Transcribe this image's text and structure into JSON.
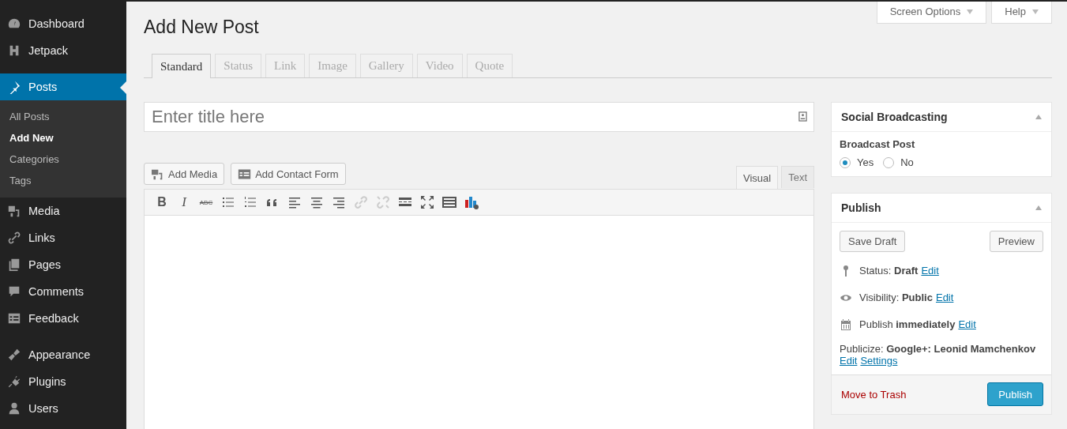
{
  "sidebar": {
    "groups": [
      [
        {
          "label": "Dashboard",
          "selected": false
        },
        {
          "label": "Jetpack",
          "selected": false
        }
      ],
      [
        {
          "label": "Posts",
          "selected": true,
          "children": [
            {
              "label": "All Posts",
              "selected": false
            },
            {
              "label": "Add New",
              "selected": true
            },
            {
              "label": "Categories",
              "selected": false
            },
            {
              "label": "Tags",
              "selected": false
            }
          ]
        },
        {
          "label": "Media",
          "selected": false
        },
        {
          "label": "Links",
          "selected": false
        },
        {
          "label": "Pages",
          "selected": false
        },
        {
          "label": "Comments",
          "selected": false
        },
        {
          "label": "Feedback",
          "selected": false
        }
      ],
      [
        {
          "label": "Appearance",
          "selected": false
        },
        {
          "label": "Plugins",
          "selected": false
        },
        {
          "label": "Users",
          "selected": false
        }
      ]
    ]
  },
  "screen_meta": [
    {
      "label": "Screen Options"
    },
    {
      "label": "Help"
    }
  ],
  "page_title": "Add New Post",
  "format_tabs": [
    {
      "label": "Standard",
      "selected": true
    },
    {
      "label": "Status",
      "selected": false
    },
    {
      "label": "Link",
      "selected": false
    },
    {
      "label": "Image",
      "selected": false
    },
    {
      "label": "Gallery",
      "selected": false
    },
    {
      "label": "Video",
      "selected": false
    },
    {
      "label": "Quote",
      "selected": false
    }
  ],
  "title_field": {
    "placeholder": "Enter title here"
  },
  "media_buttons": [
    {
      "label": "Add Media"
    },
    {
      "label": "Add Contact Form"
    }
  ],
  "editor_tabs": [
    {
      "label": "Visual",
      "selected": true
    },
    {
      "label": "Text",
      "selected": false
    }
  ],
  "toolbar": [
    {
      "kind": "bold",
      "label": "B",
      "disabled": false
    },
    {
      "kind": "italic",
      "label": "I",
      "disabled": false
    },
    {
      "kind": "strike",
      "label": "ABC",
      "disabled": false
    },
    {
      "kind": "bullets",
      "disabled": false
    },
    {
      "kind": "numbers",
      "disabled": false
    },
    {
      "kind": "quote",
      "disabled": false
    },
    {
      "kind": "align-left",
      "disabled": false
    },
    {
      "kind": "align-center",
      "disabled": false
    },
    {
      "kind": "align-right",
      "disabled": false
    },
    {
      "kind": "link",
      "disabled": true
    },
    {
      "kind": "unlink",
      "disabled": true
    },
    {
      "kind": "more",
      "disabled": false
    },
    {
      "kind": "fullscreen",
      "disabled": false
    },
    {
      "kind": "keyboard",
      "disabled": false
    },
    {
      "kind": "chart",
      "disabled": false
    }
  ],
  "social_box": {
    "title": "Social Broadcasting",
    "label": "Broadcast Post",
    "options": [
      {
        "label": "Yes",
        "selected": true
      },
      {
        "label": "No",
        "selected": false
      }
    ]
  },
  "publish_box": {
    "title": "Publish",
    "save_draft": "Save Draft",
    "preview": "Preview",
    "rows": [
      {
        "kind": "status",
        "text": "Status: **Draft**",
        "link": "Edit"
      },
      {
        "kind": "visibility",
        "text": "Visibility: **Public**",
        "link": "Edit"
      },
      {
        "kind": "schedule",
        "text": "Publish **immediately**",
        "link": "Edit"
      }
    ],
    "publicize": "Publicize: **Google+: Leonid Mamchenkov**",
    "publicize_links": [
      "Edit",
      "Settings"
    ],
    "trash": "Move to Trash",
    "publish": "Publish"
  }
}
